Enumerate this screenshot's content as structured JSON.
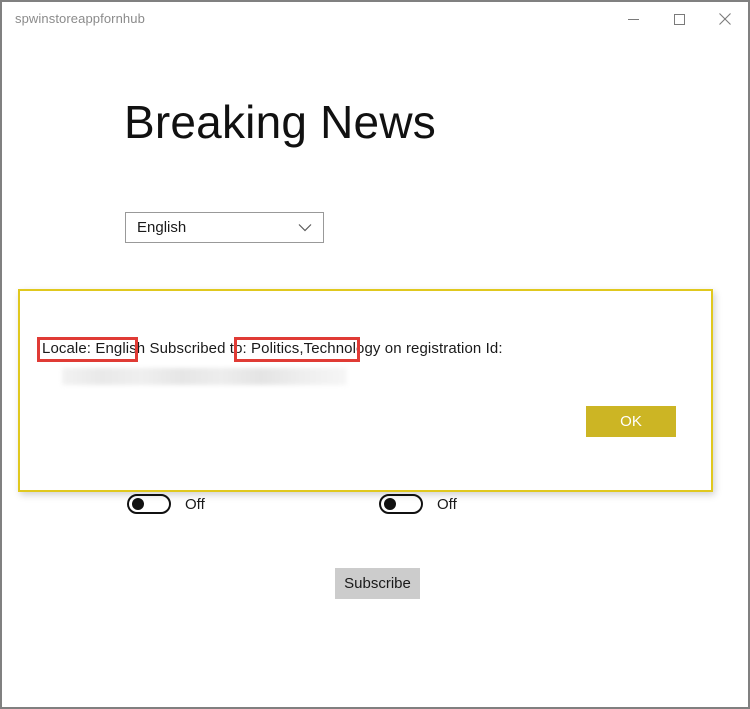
{
  "window": {
    "title": "spwinstoreappfornhub",
    "controls": [
      {
        "name": "minimize",
        "glyph": "minimize-icon"
      },
      {
        "name": "maximize",
        "glyph": "maximize-icon"
      },
      {
        "name": "close",
        "glyph": "close-icon"
      }
    ]
  },
  "page": {
    "heading": "Breaking News"
  },
  "locale_select": {
    "value": "English",
    "icon": "chevron-down-icon"
  },
  "dialog": {
    "message": "Locale: English Subscribed to: Politics,Technology on registration Id:",
    "registration_id": "",
    "ok_label": "OK",
    "border_color": "#e0c81e",
    "ok_color": "#ccb524"
  },
  "annotations": {
    "color": "#e03b35",
    "boxes": [
      {
        "label": "Locale: English"
      },
      {
        "label": "Politics,Technology"
      }
    ]
  },
  "toggles": [
    {
      "name": "politics",
      "state_label": "Off",
      "on": false
    },
    {
      "name": "technology",
      "state_label": "Off",
      "on": false
    }
  ],
  "actions": {
    "subscribe_label": "Subscribe"
  }
}
